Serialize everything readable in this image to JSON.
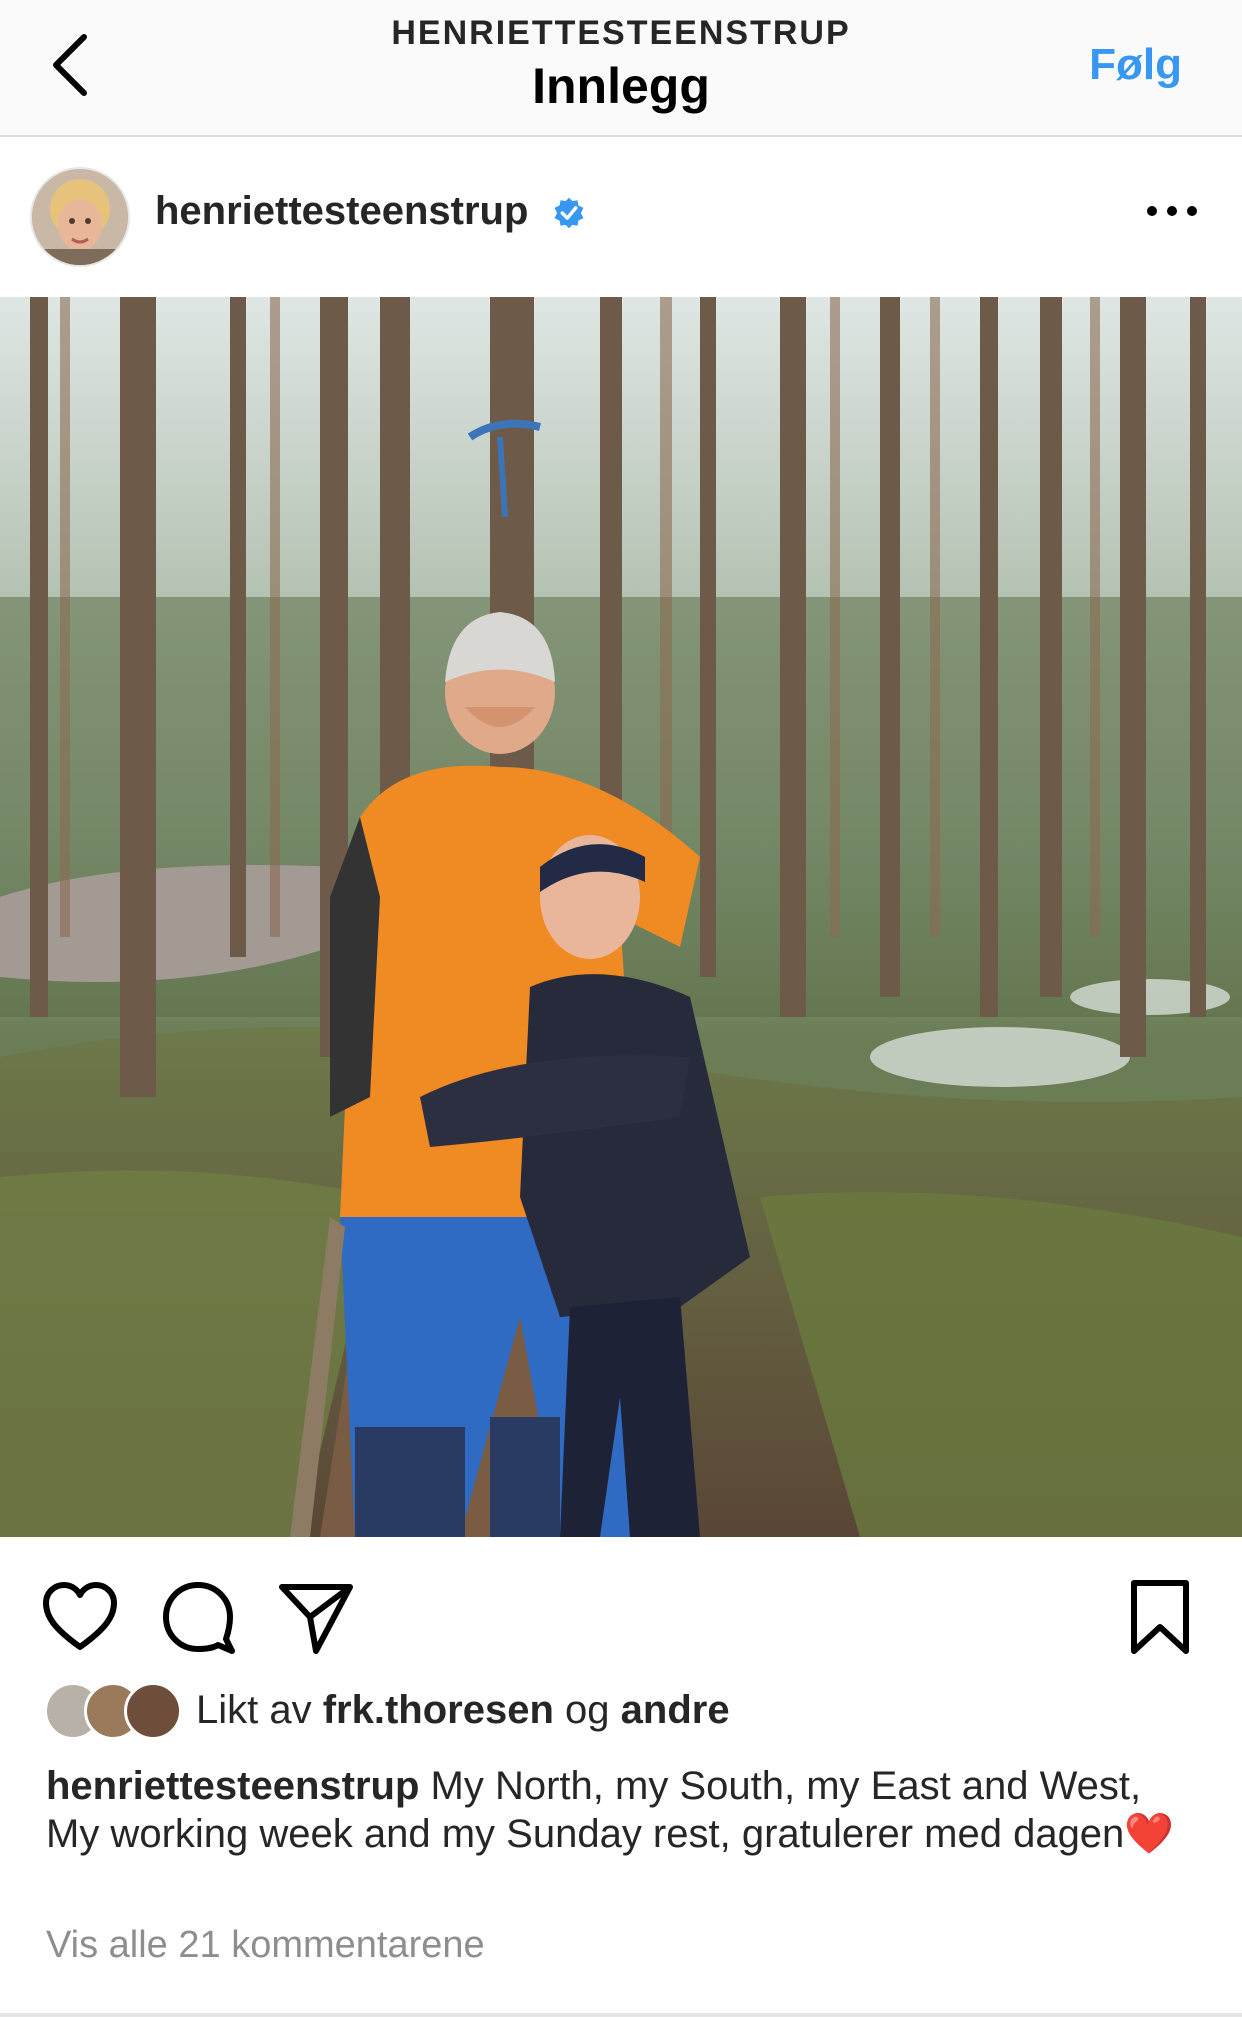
{
  "nav": {
    "subtitle": "HENRIETTESTEENSTRUP",
    "title": "Innlegg",
    "follow_label": "Følg"
  },
  "post": {
    "username": "henriettesteenstrup",
    "verified": true
  },
  "likes": {
    "prefix": "Likt av",
    "user": "frk.thoresen",
    "joiner": "og",
    "others": "andre"
  },
  "caption": {
    "username": "henriettesteenstrup",
    "text": "My North, my South, my East and West, My working week and my Sunday rest, gratulerer med dagen",
    "emoji": "❤️"
  },
  "comments": {
    "link": "Vis alle 21 kommentarene"
  },
  "colors": {
    "link_blue": "#3897f0",
    "verified_blue": "#3897f0",
    "text_primary": "#262626",
    "text_secondary": "#8e8e8e"
  },
  "icons": {
    "back": "chevron-left-icon",
    "more": "more-dots-icon",
    "like": "heart-icon",
    "comment": "comment-bubble-icon",
    "share": "paper-plane-icon",
    "save": "bookmark-icon"
  }
}
